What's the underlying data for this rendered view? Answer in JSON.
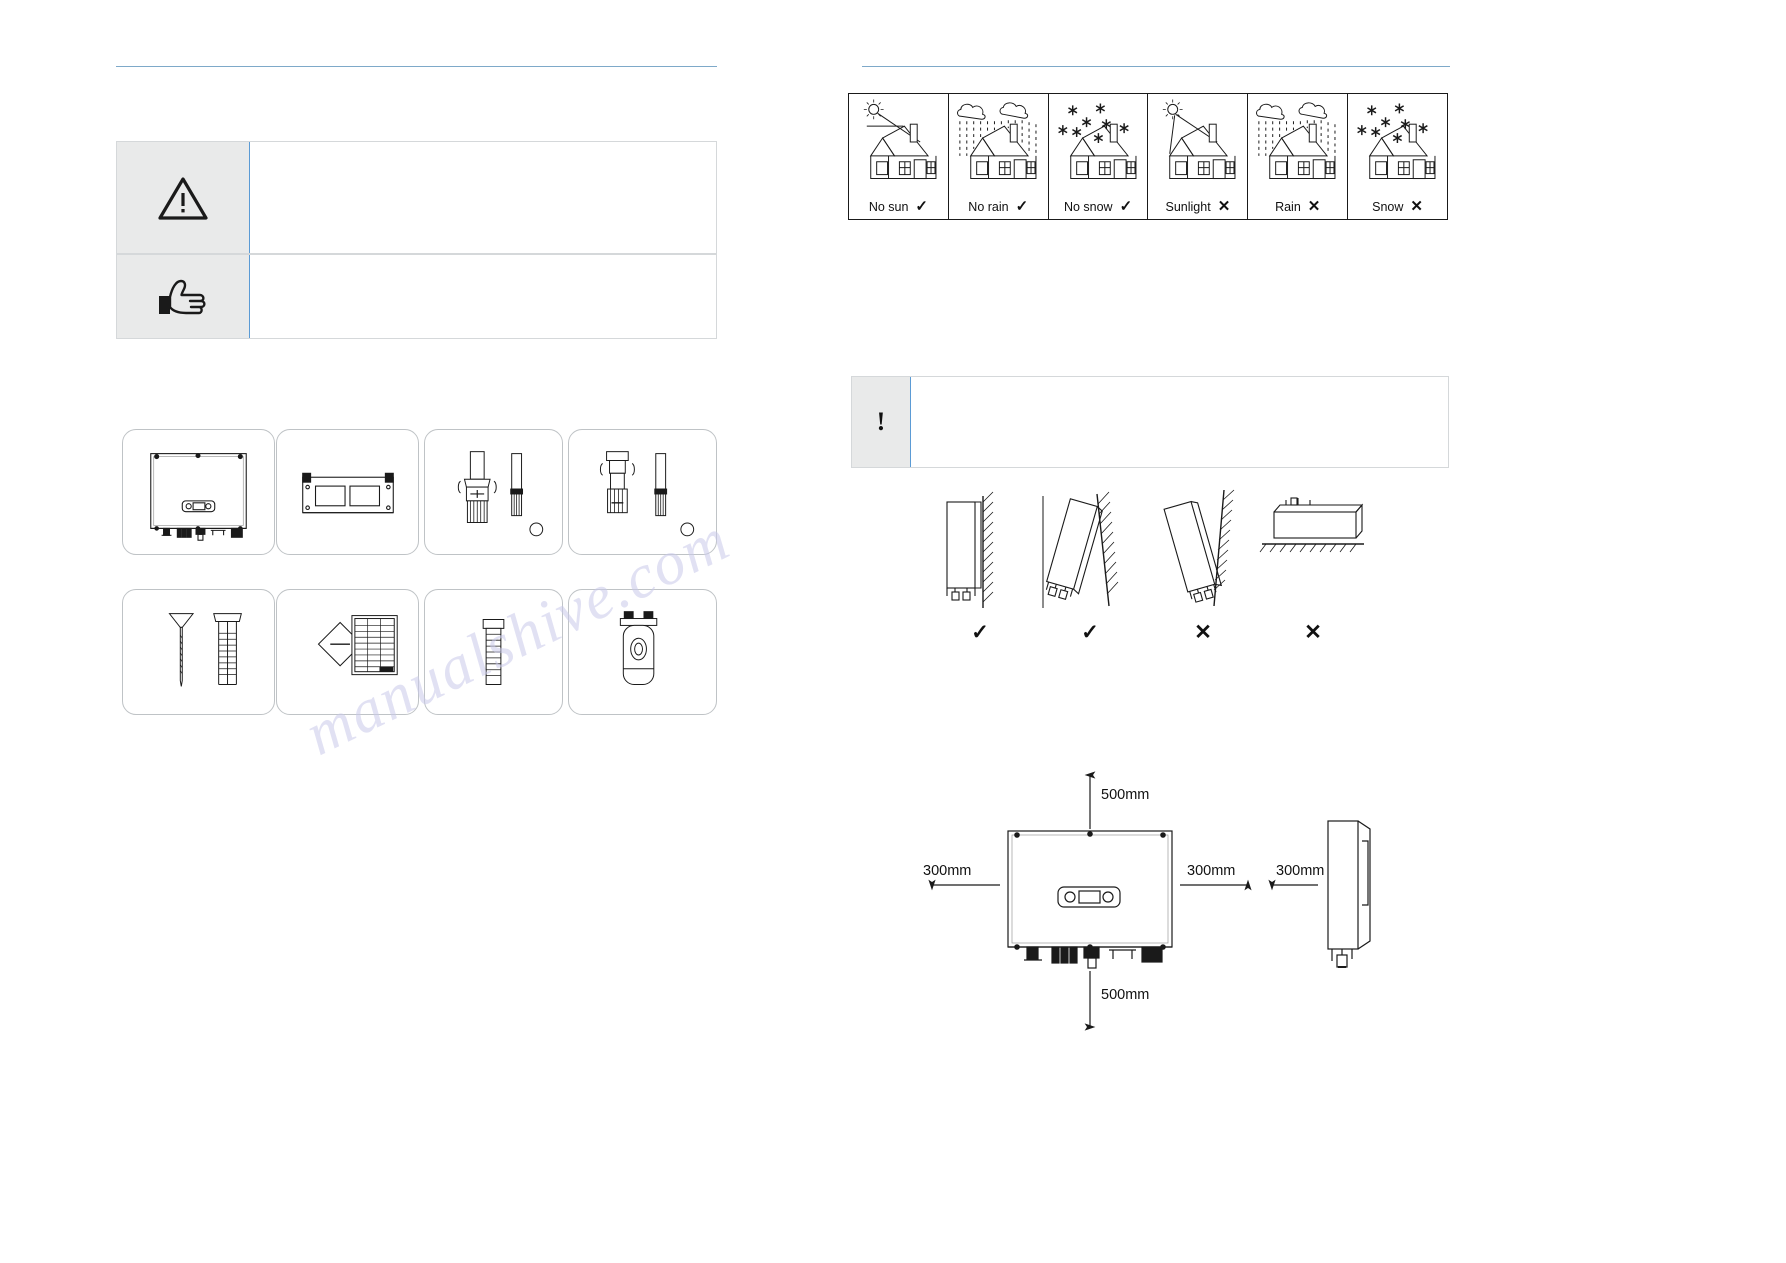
{
  "document": {
    "type": "installation-manual-page",
    "watermark_text": "manualshive.com"
  },
  "left_column": {
    "warning_box": {
      "icon": "warning-triangle-icon",
      "text": ""
    },
    "note_box": {
      "icon": "pointing-hand-icon",
      "text": ""
    },
    "packing_list": {
      "items": [
        {
          "index": 1,
          "icon": "inverter-unit-icon",
          "label": ""
        },
        {
          "index": 2,
          "icon": "mounting-bracket-icon",
          "label": ""
        },
        {
          "index": 3,
          "icon": "pv-connector-positive-icon",
          "label": ""
        },
        {
          "index": 4,
          "icon": "pv-connector-negative-icon",
          "label": ""
        },
        {
          "index": 5,
          "icon": "expansion-screws-icon",
          "label": ""
        },
        {
          "index": 6,
          "icon": "documentation-icon",
          "label": ""
        },
        {
          "index": 7,
          "icon": "bolt-screw-icon",
          "label": ""
        },
        {
          "index": 8,
          "icon": "wifi-dongle-icon",
          "label": ""
        }
      ]
    }
  },
  "right_column": {
    "site_conditions": {
      "panels": [
        {
          "label": "No sun",
          "mark": "✓",
          "ok": true,
          "scene": "house-sun-shaded-icon"
        },
        {
          "label": "No rain",
          "mark": "✓",
          "ok": true,
          "scene": "house-rain-shaded-icon"
        },
        {
          "label": "No snow",
          "mark": "✓",
          "ok": true,
          "scene": "house-snow-shaded-icon"
        },
        {
          "label": "Sunlight",
          "mark": "✕",
          "ok": false,
          "scene": "house-sun-exposed-icon"
        },
        {
          "label": "Rain",
          "mark": "✕",
          "ok": false,
          "scene": "house-rain-exposed-icon"
        },
        {
          "label": "Snow",
          "mark": "✕",
          "ok": false,
          "scene": "house-snow-exposed-icon"
        }
      ]
    },
    "notice_box": {
      "icon": "exclamation-icon",
      "symbol": "!",
      "text": ""
    },
    "mounting_orientations": [
      {
        "icon": "mount-vertical-icon",
        "mark": "✓",
        "ok": true
      },
      {
        "icon": "mount-tilted-back-icon",
        "mark": "✓",
        "ok": true
      },
      {
        "icon": "mount-tilted-forward-icon",
        "mark": "✕",
        "ok": false
      },
      {
        "icon": "mount-horizontal-icon",
        "mark": "✕",
        "ok": false
      }
    ],
    "clearance_diagram": {
      "device_icon": "inverter-front-view-icon",
      "side_device_icon": "inverter-side-view-icon",
      "dimensions": {
        "top": "500mm",
        "bottom": "500mm",
        "left": "300mm",
        "right": "300mm",
        "side_gap": "300mm"
      }
    }
  }
}
